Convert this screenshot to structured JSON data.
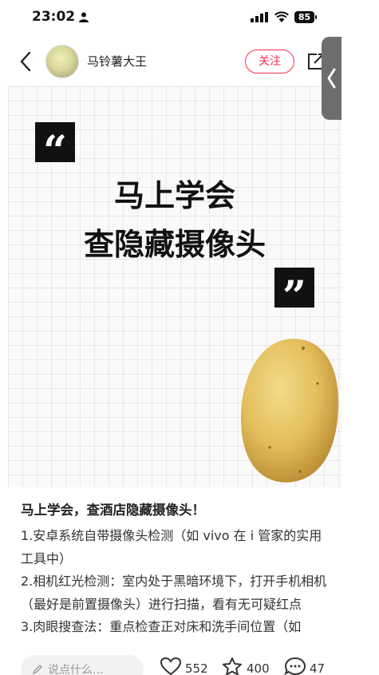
{
  "status_bar": {
    "time": "23:02",
    "battery": "85"
  },
  "header": {
    "author": "马铃薯大王",
    "follow_label": "关注"
  },
  "cover": {
    "line1": "马上学会",
    "line2": "查隐藏摄像头",
    "quote_open": "“",
    "quote_close": "”"
  },
  "post": {
    "title": "马上学会，查酒店隐藏摄像头！",
    "paragraphs": [
      "1.安卓系统自带摄像头检测（如 vivo 在 i 管家的实用工具中）",
      "2.相机红光检测：室内处于黑暗环境下，打开手机相机（最好是前置摄像头）进行扫描，看有无可疑红点",
      "3.肉眼搜查法：重点检查正对床和洗手间位置（如"
    ]
  },
  "bottom_bar": {
    "comment_placeholder": "说点什么...",
    "likes": "552",
    "stars": "400",
    "comments": "47"
  },
  "icons": [
    "person-icon",
    "signal-icon",
    "wifi-icon",
    "battery-icon",
    "back-arrow-icon",
    "share-icon",
    "side-collapse-icon",
    "pen-icon",
    "heart-icon",
    "star-icon",
    "comment-icon"
  ],
  "colors": {
    "accent": "#ff2e4d",
    "side_tab": "#6e6e6e"
  }
}
